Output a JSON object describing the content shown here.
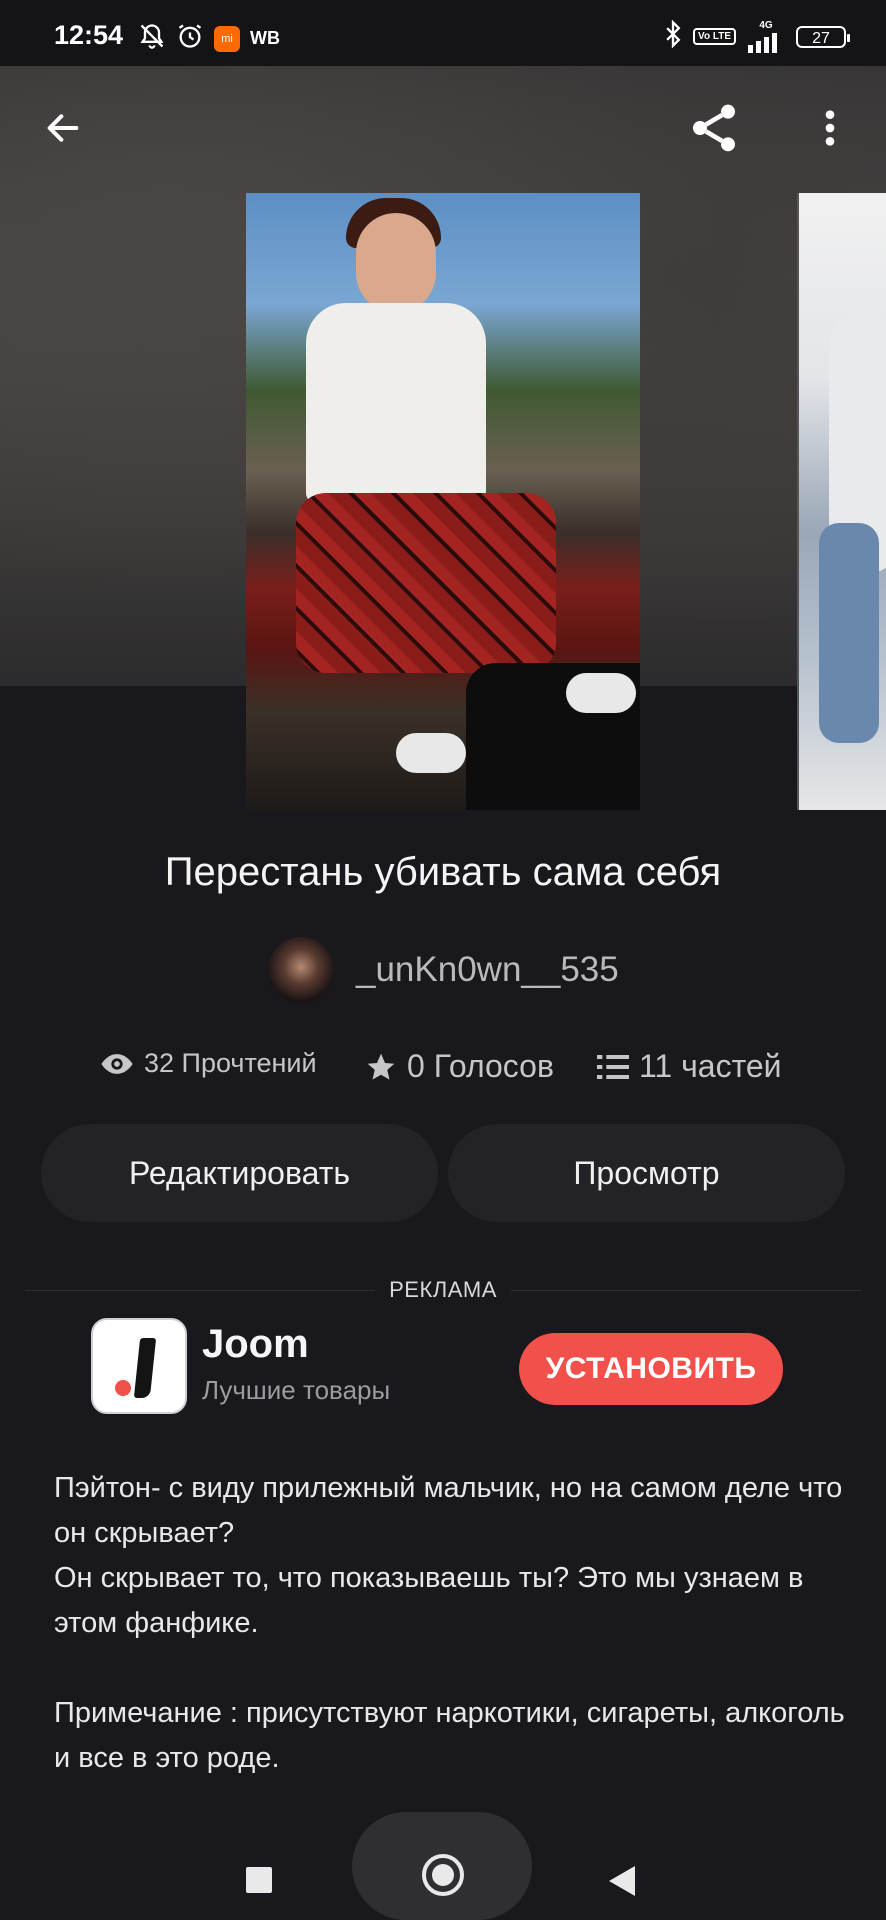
{
  "status_bar": {
    "time": "12:54",
    "carrier_badge": "WB",
    "mi_badge": "mi",
    "network_type": "4G",
    "volte": "Vo LTE",
    "battery": "27"
  },
  "story": {
    "title": "Перестань убивать сама себя",
    "author": "_unKn0wn__535",
    "stats": {
      "reads": "32 Прочтений",
      "votes": "0 Голосов",
      "parts": "11 частей"
    },
    "buttons": {
      "edit": "Редактировать",
      "preview": "Просмотр"
    },
    "description": [
      "Пэйтон- с виду прилежный мальчик, но на самом деле что он скрывает?\nОн скрывает то, что показываешь ты? Это мы узнаем в этом фанфике.",
      "Примечание : присутствуют наркотики, сигареты, алкоголь и все в это роде."
    ]
  },
  "ad": {
    "label": "РЕКЛАМА",
    "app_name": "Joom",
    "tagline": "Лучшие товары",
    "install": "УСТАНОВИТЬ",
    "accent_color": "#f2504a"
  },
  "icons": {
    "back": "arrow-left-icon",
    "share": "share-icon",
    "more": "more-vertical-icon",
    "reads": "eye-icon",
    "votes": "star-icon",
    "parts": "list-icon"
  }
}
